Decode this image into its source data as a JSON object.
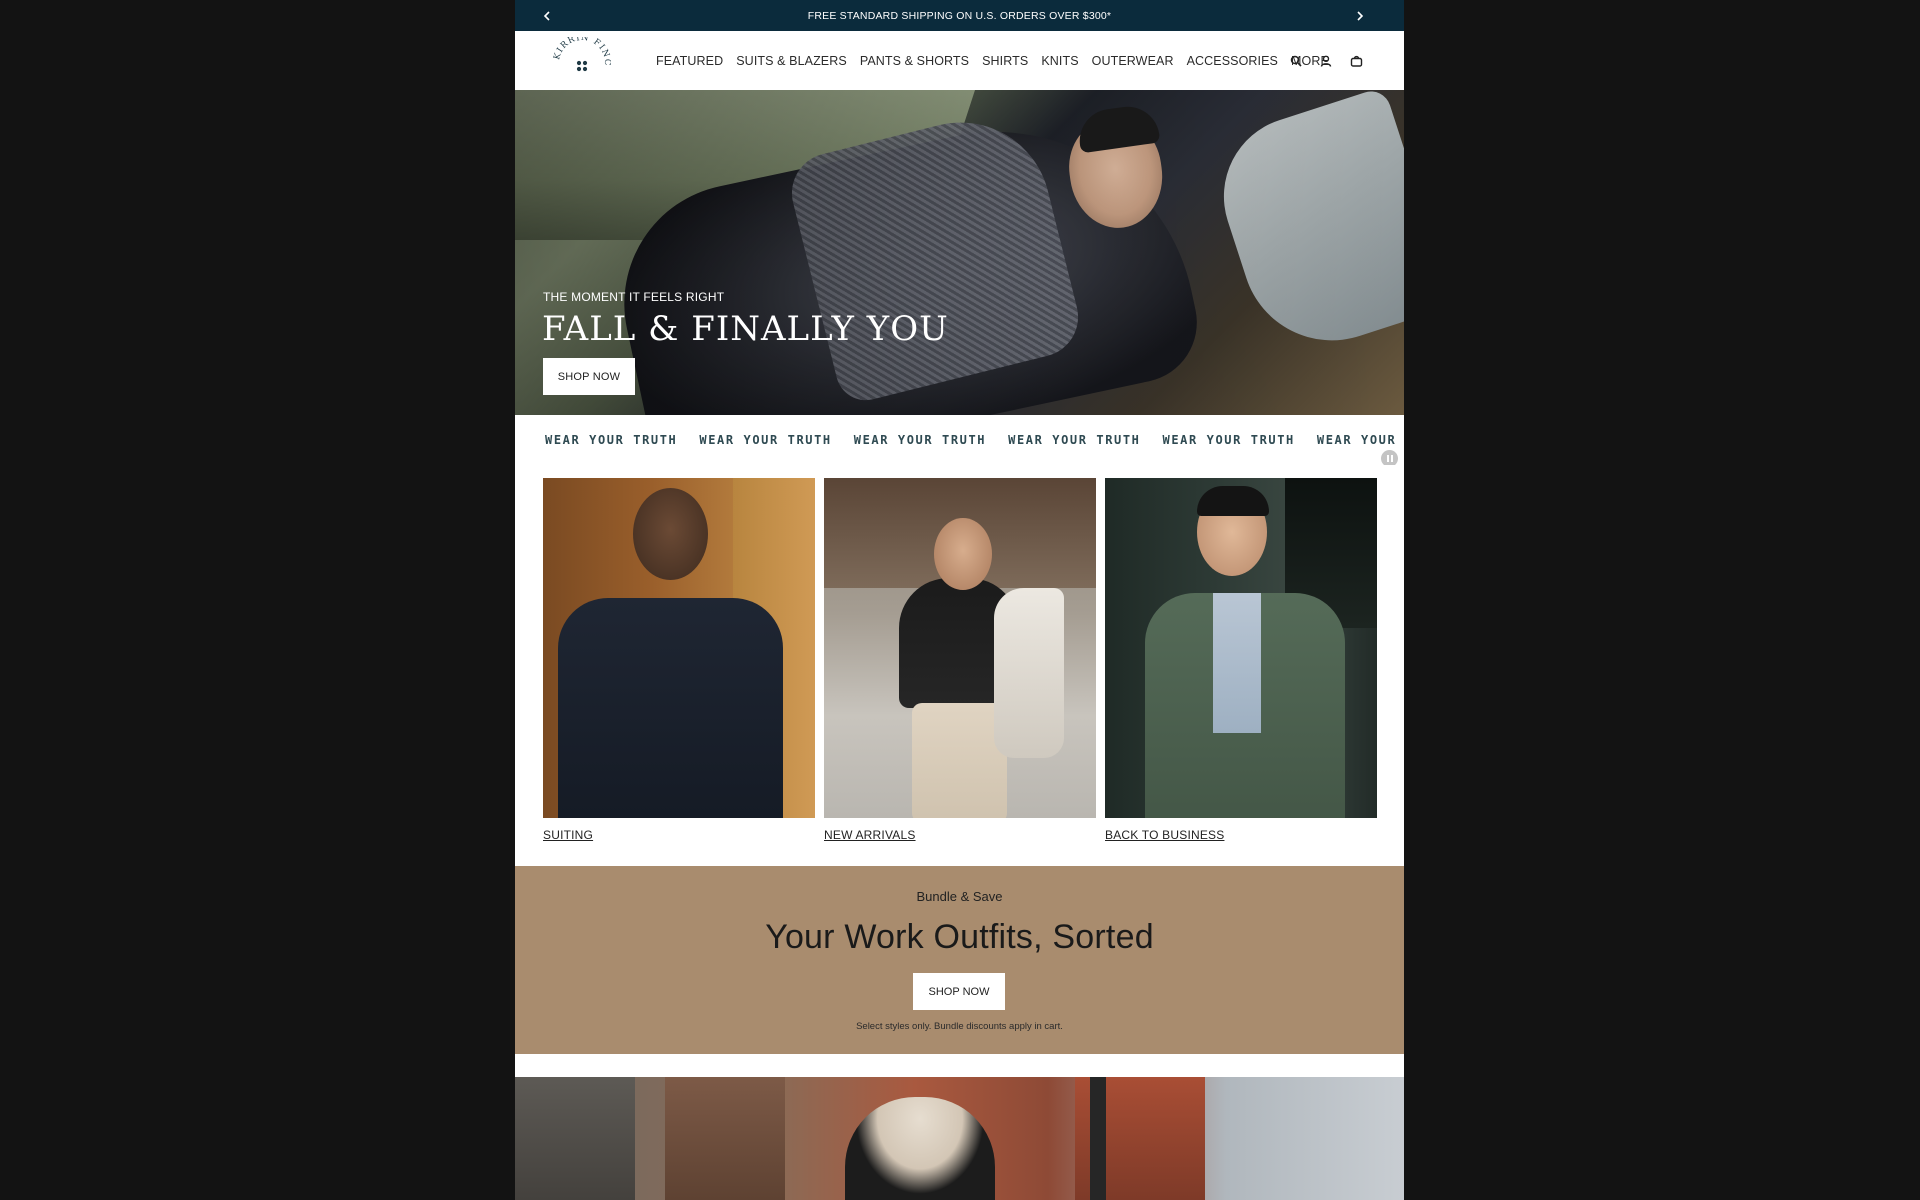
{
  "announcement": {
    "text": "FREE STANDARD SHIPPING ON U.S. ORDERS OVER $300*",
    "prev_icon": "chevron-left-icon",
    "next_icon": "chevron-right-icon"
  },
  "header": {
    "logo_text": "KIRRIN FINCH",
    "nav": [
      "FEATURED",
      "SUITS & BLAZERS",
      "PANTS & SHORTS",
      "SHIRTS",
      "KNITS",
      "OUTERWEAR",
      "ACCESSORIES",
      "MORE"
    ],
    "icons": [
      "search-icon",
      "account-icon",
      "cart-icon"
    ]
  },
  "hero": {
    "kicker": "THE MOMENT IT FEELS RIGHT",
    "title": "FALL & FINALLY YOU",
    "button": "SHOP NOW"
  },
  "marquee": {
    "items": [
      "WEAR YOUR TRUTH",
      "WEAR YOUR TRUTH",
      "WEAR YOUR TRUTH",
      "WEAR YOUR TRUTH",
      "WEAR YOUR TRUTH",
      "WEAR YOUR TRUTH"
    ]
  },
  "cards": [
    {
      "label": "SUITING"
    },
    {
      "label": "NEW ARRIVALS"
    },
    {
      "label": "BACK TO BUSINESS"
    }
  ],
  "bundle": {
    "kicker": "Bundle & Save",
    "title": "Your Work Outfits, Sorted",
    "button": "SHOP NOW",
    "note": "Select styles only. Bundle discounts apply in cart."
  },
  "colors": {
    "announcement_bg": "#0b2b3c",
    "bundle_bg": "#a98c6e",
    "marquee_text": "#2f4a52"
  }
}
